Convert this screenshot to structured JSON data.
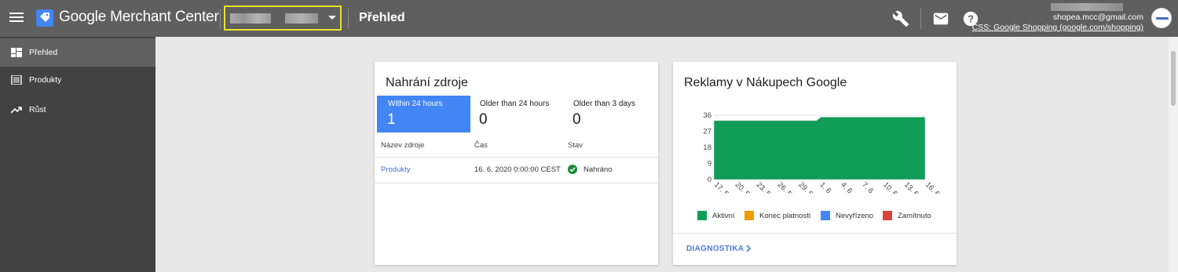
{
  "header": {
    "app_title": "Google Merchant Center",
    "page_title": "Přehled",
    "account_email": "shopea.mcc@gmail.com",
    "css_link": "CSS: Google Shopping (google.com/shopping)"
  },
  "sidebar": {
    "items": [
      {
        "label": "Přehled",
        "icon": "dashboard-icon",
        "active": true
      },
      {
        "label": "Produkty",
        "icon": "list-icon",
        "active": false
      },
      {
        "label": "Růst",
        "icon": "trending-up-icon",
        "active": false
      }
    ]
  },
  "feed_card": {
    "title": "Nahrání zdroje",
    "stats": [
      {
        "label": "Within 24 hours",
        "value": "1",
        "active": true
      },
      {
        "label": "Older than 24 hours",
        "value": "0",
        "active": false
      },
      {
        "label": "Older than 3 days",
        "value": "0",
        "active": false
      }
    ],
    "columns": [
      "Název zdroje",
      "Čas",
      "Stav"
    ],
    "rows": [
      {
        "name": "Produkty",
        "time": "16. 6. 2020 0:00:00 CEST",
        "status": "Nahráno"
      }
    ]
  },
  "ads_card": {
    "title": "Reklamy v Nákupech Google",
    "legend": [
      {
        "label": "Aktivní",
        "color": "#0f9d58"
      },
      {
        "label": "Konec platnosti",
        "color": "#f29900"
      },
      {
        "label": "Nevyřízeno",
        "color": "#4285f4"
      },
      {
        "label": "Zamítnuto",
        "color": "#db4437"
      }
    ],
    "diagnostics_label": "DIAGNOSTIKA"
  },
  "chart_data": {
    "type": "area",
    "x": [
      "17. 5",
      "20. 5",
      "23. 5",
      "26. 5",
      "29. 5",
      "1. 6",
      "4. 6",
      "7. 6",
      "10. 6",
      "13. 6",
      "16. 6"
    ],
    "y_ticks": [
      0,
      9,
      18,
      27,
      36
    ],
    "ylim": [
      0,
      36
    ],
    "series": [
      {
        "name": "Aktivní",
        "color": "#0f9d58",
        "values": [
          33,
          33,
          33,
          33,
          33,
          35,
          35,
          35,
          35,
          35,
          35
        ]
      },
      {
        "name": "Konec platnosti",
        "color": "#f29900",
        "values": [
          0,
          0,
          0,
          0,
          0,
          0,
          0,
          0,
          0,
          0,
          0
        ]
      },
      {
        "name": "Nevyřízeno",
        "color": "#4285f4",
        "values": [
          0,
          0,
          0,
          0,
          0,
          0,
          0,
          0,
          0,
          0,
          0
        ]
      },
      {
        "name": "Zamítnuto",
        "color": "#db4437",
        "values": [
          0,
          0,
          0,
          0,
          0,
          0,
          0,
          0,
          0,
          0,
          0
        ]
      }
    ],
    "grid": true,
    "legend_position": "bottom"
  }
}
